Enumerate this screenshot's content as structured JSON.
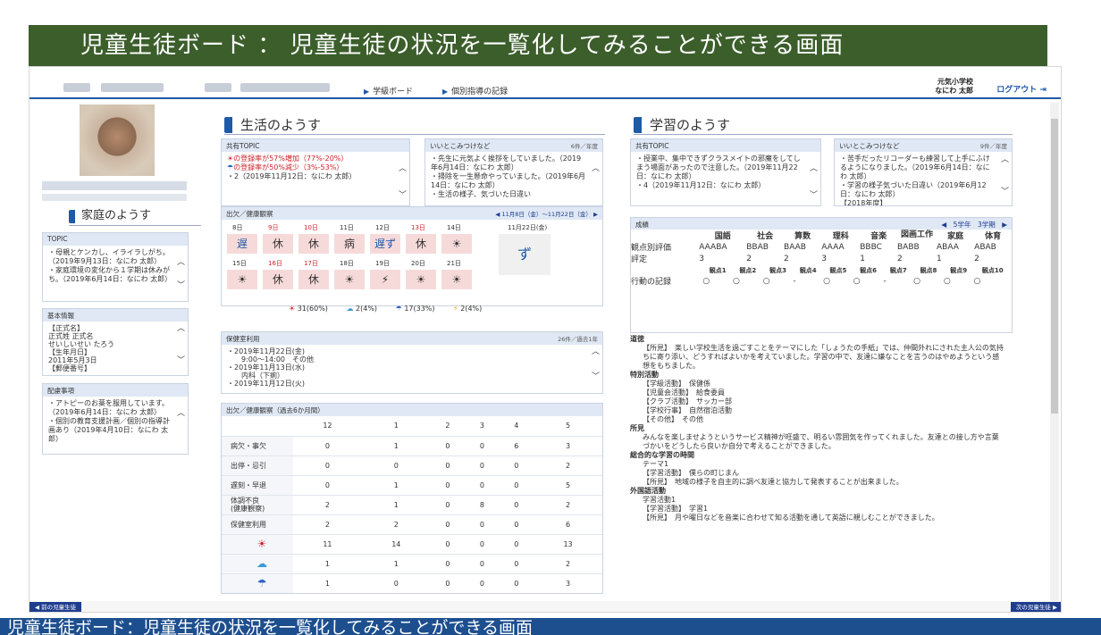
{
  "banner_title": "児童生徒ボード ： 児童生徒の状況を一覧化してみることができる画面",
  "caption_text": "児童生徒ボード：児童生徒の状況を一覧化してみることができる画面",
  "nav": {
    "link1": "学級ボード",
    "link2": "個別指導の記録",
    "school": "元気小学校",
    "teacher": "なにわ 太郎",
    "logout": "ログアウト"
  },
  "left": {
    "home_title": "家庭のようす",
    "topic_head": "TOPIC",
    "topic_body": [
      "・母親とケンカし、イライラしがち。（2019年9月13日：なにわ 太郎）",
      "・家庭環境の変化から１学期は休みがち。（2019年6月14日：なにわ 太郎）"
    ],
    "basic_head": "基本情報",
    "basic_body": [
      "【正式名】",
      "正式姓 正式名",
      "せいしいせい たろう",
      "【生年月日】",
      "2011年5月3日",
      "【郵便番号】"
    ],
    "care_head": "配慮事項",
    "care_body": [
      "・アトピーのお薬を服用しています。（2019年6月14日：なにわ 太郎）",
      "・個別の教育支援計画／個別の指導計画あり（2019年4月10日：なにわ 太郎）"
    ]
  },
  "life": {
    "title": "生活のようす",
    "shared_head": "共有TOPIC",
    "shared_body": [
      "の登録率が57%増加（77%-20%）",
      "の登録率が50%減少（3%-53%）",
      "・2（2019年11月12日：なにわ 太郎）"
    ],
    "good_head": "いいとこみつけなど",
    "good_count": "6件／年度",
    "good_body": [
      "・先生に元気よく挨拶をしていました。（2019年6月14日：なにわ 太郎）",
      "・掃除を一生懸命やっていました。（2019年6月14日：なにわ 太郎）",
      "・生活の様子、気づいた日違い"
    ],
    "cal_head": "出欠／健康観察",
    "cal_range": "◀ 11月8日（金）～11月22日（金） ▶",
    "week1": [
      "8日",
      "9日",
      "10日",
      "11日",
      "12日",
      "13日",
      "14日",
      "11月22日(金)"
    ],
    "week2": [
      "15日",
      "16日",
      "17日",
      "18日",
      "19日",
      "20日",
      "21日"
    ],
    "row1": [
      "遅",
      "休",
      "休",
      "病",
      "遅ず",
      "休",
      "☀",
      "ず"
    ],
    "row2": [
      "☀",
      "休",
      "休",
      "☀",
      "⚡",
      "☀",
      "☀"
    ],
    "legend": [
      "31(60%)",
      "2(4%)",
      "17(33%)",
      "2(4%)"
    ],
    "health_head": "保健室利用",
    "health_count": "26件／過去1年",
    "health_body": [
      "・2019年11月22日(金)",
      "　　9:00～14:00　その他",
      "・2019年11月13日(水)",
      "　　内科（下痢）",
      "・2019年11月12日(火)"
    ],
    "att_head": "出欠／健康観察（過去6か月間）",
    "att_months": [
      "12",
      "1",
      "2",
      "3",
      "4",
      "5"
    ],
    "att_rows": [
      {
        "label": "病欠・事欠",
        "vals": [
          "0",
          "1",
          "0",
          "0",
          "6",
          "3"
        ]
      },
      {
        "label": "出停・忌引",
        "vals": [
          "0",
          "0",
          "0",
          "0",
          "0",
          "2"
        ]
      },
      {
        "label": "遅刻・早退",
        "vals": [
          "0",
          "1",
          "0",
          "0",
          "0",
          "5"
        ]
      },
      {
        "label": "体調不良\n(健康観察)",
        "vals": [
          "2",
          "1",
          "0",
          "8",
          "0",
          "2"
        ]
      },
      {
        "label": "保健室利用",
        "vals": [
          "2",
          "2",
          "0",
          "0",
          "0",
          "6"
        ]
      },
      {
        "label": "☀",
        "vals": [
          "11",
          "14",
          "0",
          "0",
          "0",
          "13"
        ]
      },
      {
        "label": "☁",
        "vals": [
          "1",
          "1",
          "0",
          "0",
          "0",
          "2"
        ]
      },
      {
        "label": "☂",
        "vals": [
          "1",
          "0",
          "0",
          "0",
          "0",
          "3"
        ]
      }
    ]
  },
  "learn": {
    "title": "学習のようす",
    "shared_head": "共有TOPIC",
    "shared_body": [
      "・授業中、集中できずクラスメイトの邪魔をしてしまう場面があったので注意した。（2019年11月22日：なにわ 太郎）",
      "・4（2019年11月12日：なにわ 太郎）"
    ],
    "good_head": "いいとこみつけなど",
    "good_count": "9件／年度",
    "good_body": [
      "・苦手だったリコーダーも練習して上手にふけるようになりました。（2019年6月14日：なにわ 太郎）",
      "・学習の様子気づいた日違い（2019年6月12日：なにわ 太郎）",
      "【2018年度】"
    ],
    "grade_head": "成績",
    "grade_term": "◀　5学年　3学期　▶",
    "subjects": [
      "国語",
      "社会",
      "算数",
      "理科",
      "音楽",
      "図画工作",
      "家庭",
      "体育"
    ],
    "kanten": [
      "AAABA",
      "BBAB",
      "BAAB",
      "AAAA",
      "BBBC",
      "BABB",
      "ABAA",
      "ABAB"
    ],
    "hyotei": [
      "3",
      "2",
      "2",
      "3",
      "1",
      "2",
      "1",
      "2"
    ],
    "kanten_lbl": "観点別評価",
    "hyotei_lbl": "評定",
    "points": [
      "観点1",
      "観点2",
      "観点3",
      "観点4",
      "観点5",
      "観点6",
      "観点7",
      "観点8",
      "観点9",
      "観点10"
    ],
    "action_lbl": "行動の記録",
    "actions": [
      "○",
      "○",
      "○",
      "-",
      "○",
      "○",
      "-",
      "○",
      "○",
      "○"
    ],
    "notes": [
      {
        "h": "道徳",
        "t": "【所見】　楽しい学校生活を過ごすことをテーマにした「しょうたの手紙」では、仲間外れにされた主人公の気持ちに寄り添い、どうすればよいかを考えていました。学習の中で、友達に嫌なことを言うのはやめようという感想をもちました。"
      },
      {
        "h": "特別活動",
        "t": "【学級活動】　保健係\n【児童会活動】　給食委員\n【クラブ活動】　サッカー部\n【学校行事】　自然宿泊活動\n【その他】　その他"
      },
      {
        "h": "所見",
        "t": "みんなを楽しませようというサービス精神が旺盛で、明るい雰囲気を作ってくれました。友達との接し方や言葉づかいをどうしたら良いか自分で考えることができました。"
      },
      {
        "h": "総合的な学習の時間",
        "t": "テーマ1\n【学習活動】　僕らの町じまん\n【所見】　地域の様子を自主的に調べ友達と協力して発表することが出来ました。"
      },
      {
        "h": "外国語活動",
        "t": "学習活動1\n【学習活動】　学習1\n【所見】　月や曜日などを音楽に合わせて知る活動を通して英語に親しむことができました。"
      }
    ]
  },
  "footer": {
    "prev": "◀ 前の児童生徒",
    "next": "次の児童生徒 ▶"
  },
  "colors": {
    "banner": "#3b5e2b",
    "accent": "#1e5aa8",
    "caption": "#1d4f8f"
  }
}
